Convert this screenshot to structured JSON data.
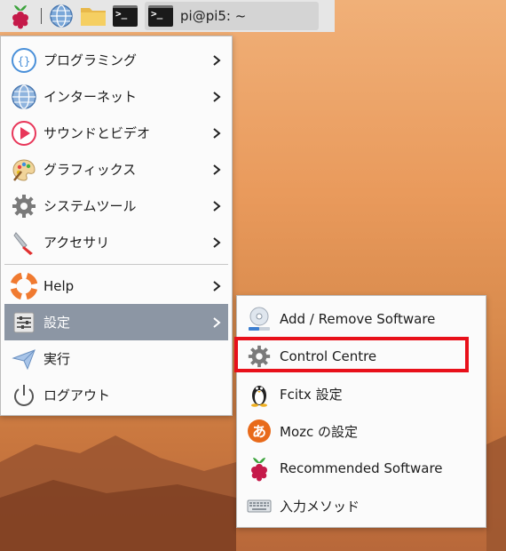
{
  "taskbar": {
    "window_title": "pi@pi5: ~",
    "icons": [
      "raspberry-pi-menu-icon",
      "web-browser-icon",
      "file-manager-icon",
      "terminal-icon"
    ]
  },
  "menu": {
    "items": [
      {
        "label": "プログラミング",
        "icon": "programming-icon",
        "has_submenu": true
      },
      {
        "label": "インターネット",
        "icon": "internet-globe-icon",
        "has_submenu": true
      },
      {
        "label": "サウンドとビデオ",
        "icon": "sound-video-icon",
        "has_submenu": true
      },
      {
        "label": "グラフィックス",
        "icon": "graphics-palette-icon",
        "has_submenu": true
      },
      {
        "label": "システムツール",
        "icon": "system-tools-gear-icon",
        "has_submenu": true
      },
      {
        "label": "アクセサリ",
        "icon": "accessories-knife-icon",
        "has_submenu": true
      },
      {
        "label": "Help",
        "icon": "help-lifebuoy-icon",
        "has_submenu": true
      },
      {
        "label": "設定",
        "icon": "settings-icon",
        "has_submenu": true,
        "selected": true
      },
      {
        "label": "実行",
        "icon": "run-paper-plane-icon",
        "has_submenu": false
      },
      {
        "label": "ログアウト",
        "icon": "logout-power-icon",
        "has_submenu": false
      }
    ]
  },
  "submenu": {
    "items": [
      {
        "label": "Add / Remove Software",
        "icon": "add-remove-software-icon"
      },
      {
        "label": "Control Centre",
        "icon": "control-centre-gear-icon",
        "highlighted": true
      },
      {
        "label": "Fcitx 設定",
        "icon": "fcitx-penguin-icon"
      },
      {
        "label": "Mozc の設定",
        "icon": "mozc-icon"
      },
      {
        "label": "Recommended Software",
        "icon": "raspberry-pi-icon"
      },
      {
        "label": "入力メソッド",
        "icon": "keyboard-icon"
      }
    ]
  },
  "colors": {
    "selection": "#8c96a4",
    "highlight_box": "#e8101a",
    "taskbar": "#e6e6e6"
  }
}
